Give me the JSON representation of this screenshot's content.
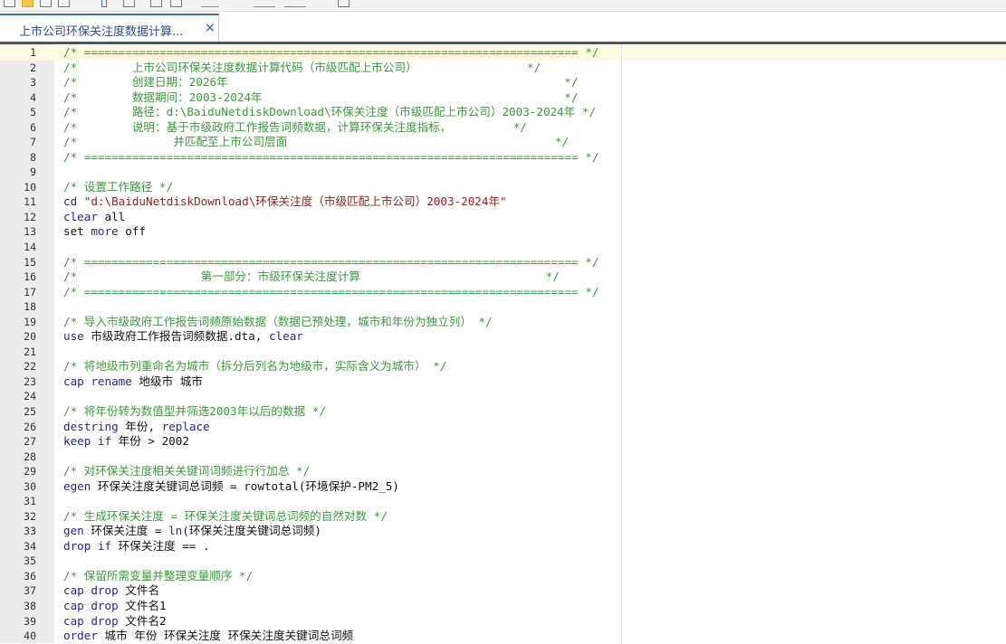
{
  "tab": {
    "title": "上市公司环保关注度数据计算...",
    "close": "×"
  },
  "colors": {
    "comment": "#3a9a3a",
    "keyword": "#25258f",
    "string": "#8e2323",
    "tab_accent": "#3c6fa8",
    "current_line": "#fdfbe0"
  },
  "editor": {
    "current_line": 1,
    "lines": [
      [
        [
          "cm",
          "/* ======================================================================== */"
        ]
      ],
      [
        [
          "cm",
          "/*        上市公司环保关注度数据计算代码（市级匹配上市公司）                */"
        ]
      ],
      [
        [
          "cm",
          "/*        创建日期：2026年                                                 */"
        ]
      ],
      [
        [
          "cm",
          "/*        数据期间：2003-2024年                                            */"
        ]
      ],
      [
        [
          "cm",
          "/*        路径：d:\\BaiduNetdiskDownload\\环保关注度（市级匹配上市公司）2003-2024年 */"
        ]
      ],
      [
        [
          "cm",
          "/*        说明：基于市级政府工作报告词频数据，计算环保关注度指标，         */"
        ]
      ],
      [
        [
          "cm",
          "/*              并匹配至上市公司层面                                       */"
        ]
      ],
      [
        [
          "cm",
          "/* ======================================================================== */"
        ]
      ],
      [],
      [
        [
          "cm",
          "/* 设置工作路径 */"
        ]
      ],
      [
        [
          "kw",
          "cd "
        ],
        [
          "str",
          "\"d:\\BaiduNetdiskDownload\\环保关注度（市级匹配上市公司）2003-2024年\""
        ]
      ],
      [
        [
          "kw",
          "clear"
        ],
        [
          "txt",
          " all"
        ]
      ],
      [
        [
          "txt",
          "set "
        ],
        [
          "kw",
          "more"
        ],
        [
          "txt",
          " off"
        ]
      ],
      [],
      [
        [
          "cm",
          "/* ======================================================================== */"
        ]
      ],
      [
        [
          "cm",
          "/*                  第一部分：市级环保关注度计算                           */"
        ]
      ],
      [
        [
          "cm",
          "/* ======================================================================== */"
        ]
      ],
      [],
      [
        [
          "cm",
          "/* 导入市级政府工作报告词频原始数据（数据已预处理，城市和年份为独立列） */"
        ]
      ],
      [
        [
          "kw",
          "use"
        ],
        [
          "txt",
          " 市级政府工作报告词频数据.dta, "
        ],
        [
          "kw",
          "clear"
        ]
      ],
      [],
      [
        [
          "cm",
          "/* 将地级市列重命名为城市（拆分后列名为地级市，实际含义为城市） */"
        ]
      ],
      [
        [
          "kw",
          "cap rename"
        ],
        [
          "txt",
          " 地级市 城市"
        ]
      ],
      [],
      [
        [
          "cm",
          "/* 将年份转为数值型并筛选2003年以后的数据 */"
        ]
      ],
      [
        [
          "kw",
          "destring"
        ],
        [
          "txt",
          " 年份, "
        ],
        [
          "kw",
          "replace"
        ]
      ],
      [
        [
          "kw",
          "keep if"
        ],
        [
          "txt",
          " 年份 > 2002"
        ]
      ],
      [],
      [
        [
          "cm",
          "/* 对环保关注度相关关键词词频进行行加总 */"
        ]
      ],
      [
        [
          "kw",
          "egen"
        ],
        [
          "txt",
          " 环保关注度关键词总词频 = rowtotal(环境保护-PM2_5)"
        ]
      ],
      [],
      [
        [
          "cm",
          "/* 生成环保关注度 = 环保关注度关键词总词频的自然对数 */"
        ]
      ],
      [
        [
          "kw",
          "gen"
        ],
        [
          "txt",
          " 环保关注度 = "
        ],
        [
          "kw",
          "ln"
        ],
        [
          "txt",
          "(环保关注度关键词总词频)"
        ]
      ],
      [
        [
          "kw",
          "drop if"
        ],
        [
          "txt",
          " 环保关注度 == ."
        ]
      ],
      [],
      [
        [
          "cm",
          "/* 保留所需变量并整理变量顺序 */"
        ]
      ],
      [
        [
          "kw",
          "cap drop"
        ],
        [
          "txt",
          " 文件名"
        ]
      ],
      [
        [
          "kw",
          "cap drop"
        ],
        [
          "txt",
          " 文件名1"
        ]
      ],
      [
        [
          "kw",
          "cap drop"
        ],
        [
          "txt",
          " 文件名2"
        ]
      ],
      [
        [
          "kw",
          "order"
        ],
        [
          "txt",
          " 城市 年份 环保关注度 环保关注度关键词总词频"
        ]
      ]
    ]
  }
}
